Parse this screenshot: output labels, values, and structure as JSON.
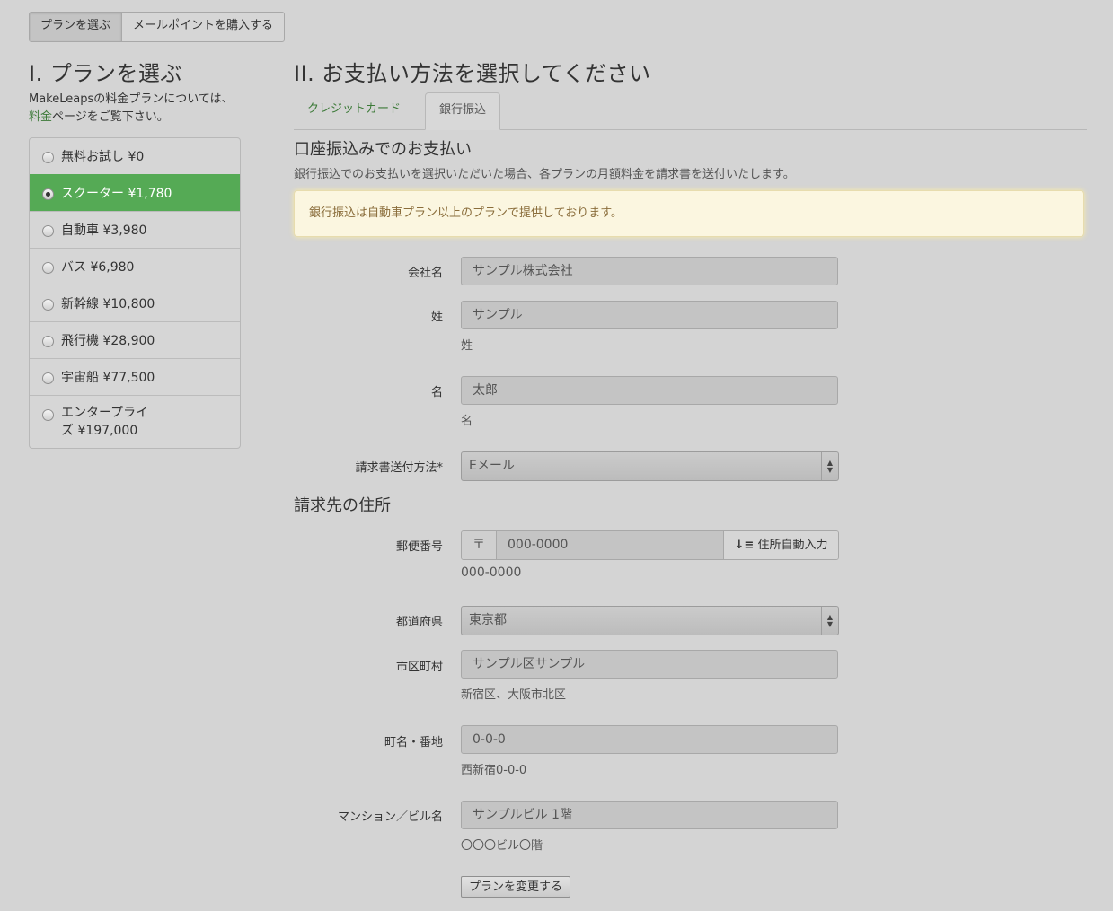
{
  "top_tabs": [
    {
      "label": "プランを選ぶ",
      "active": true
    },
    {
      "label": "メールポイントを購入する",
      "active": false
    }
  ],
  "left": {
    "heading": "I. プランを選ぶ",
    "intro_before": "MakeLeapsの料金プランについては、",
    "intro_link": "料金",
    "intro_after": "ページをご覧下さい。",
    "plans": [
      {
        "label": "無料お試し ¥0",
        "selected": false
      },
      {
        "label": "スクーター ¥1,780",
        "selected": true
      },
      {
        "label": "自動車 ¥3,980",
        "selected": false
      },
      {
        "label": "バス ¥6,980",
        "selected": false
      },
      {
        "label": "新幹線 ¥10,800",
        "selected": false
      },
      {
        "label": "飛行機 ¥28,900",
        "selected": false
      },
      {
        "label": "宇宙船 ¥77,500",
        "selected": false
      },
      {
        "label": "エンタープライ\nズ ¥197,000",
        "selected": false
      }
    ]
  },
  "right": {
    "heading": "II. お支払い方法を選択してください",
    "tabs": [
      {
        "label": "クレジットカード",
        "active": false
      },
      {
        "label": "銀行振込",
        "active": true
      }
    ],
    "section_title": "口座振込みでのお支払い",
    "description": "銀行振込でのお支払いを選択いただいた場合、各プランの月額料金を請求書を送付いたします。",
    "notice": "銀行振込は自動車プラン以上のプランで提供しております。",
    "form": {
      "company": {
        "label": "会社名",
        "value": "サンプル株式会社"
      },
      "last_name": {
        "label": "姓",
        "value": "サンプル",
        "help": "姓"
      },
      "first_name": {
        "label": "名",
        "value": "太郎",
        "help": "名"
      },
      "delivery": {
        "label": "請求書送付方法*",
        "value": "Eメール"
      }
    },
    "address_title": "請求先の住所",
    "address": {
      "postal": {
        "label": "郵便番号",
        "prefix": "〒",
        "value": "000-0000",
        "button": "住所自動入力",
        "help": "000-0000"
      },
      "prefecture": {
        "label": "都道府県",
        "value": "東京都"
      },
      "city": {
        "label": "市区町村",
        "value": "サンプル区サンプル",
        "help": "新宿区、大阪市北区"
      },
      "street": {
        "label": "町名・番地",
        "value": "0-0-0",
        "help": "西新宿0-0-0"
      },
      "building": {
        "label": "マンション／ビル名",
        "value": "サンプルビル 1階",
        "help": "〇〇〇ビル〇階"
      }
    },
    "submit_label": "プランを変更する"
  },
  "colors": {
    "accent_green": "#55aa55",
    "link_green": "#3c7a38",
    "notice_bg": "#fbf6e0",
    "notice_text": "#8a6d3b"
  }
}
